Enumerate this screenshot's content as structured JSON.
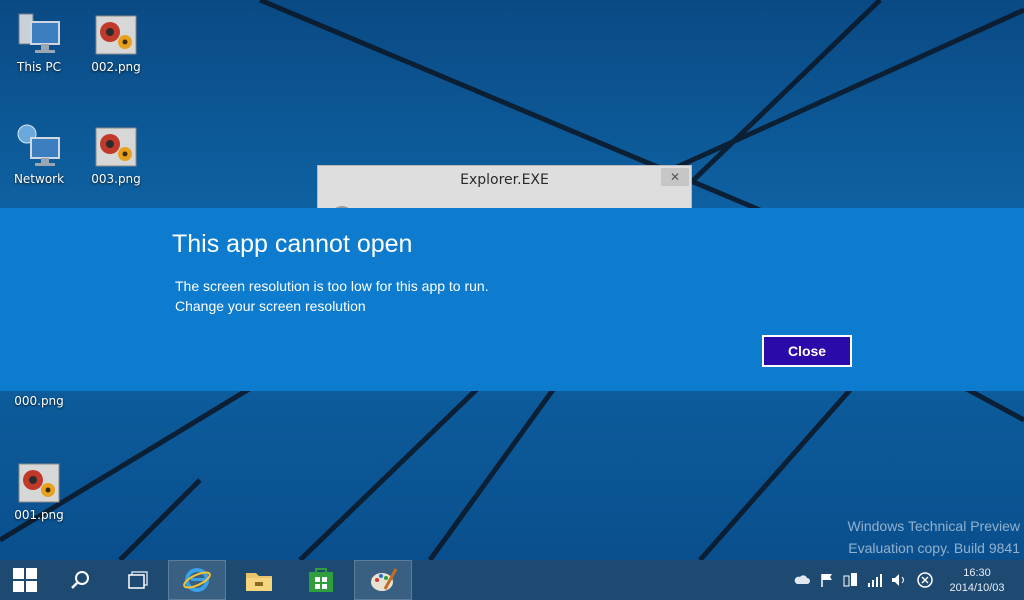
{
  "desktop_icons": [
    {
      "label": "This PC",
      "icon": "computer-icon"
    },
    {
      "label": "002.png",
      "icon": "image-icon"
    },
    {
      "label": "Network",
      "icon": "network-icon"
    },
    {
      "label": "003.png",
      "icon": "image-icon"
    },
    {
      "label": "000.png",
      "icon": "image-icon"
    },
    {
      "label": "001.png",
      "icon": "image-icon"
    }
  ],
  "background_window": {
    "title": "Explorer.EXE",
    "close_glyph": "✕"
  },
  "dialog": {
    "title": "This app cannot open",
    "message_line1": "The screen resolution is too low for this app to run.",
    "message_line2": "Change your screen resolution",
    "close_label": "Close",
    "band_color": "#0d7ccf",
    "button_color": "#2a0aa8"
  },
  "watermark": {
    "line1": "Windows Technical Preview",
    "line2": "Evaluation copy. Build 9841"
  },
  "taskbar": {
    "items": [
      {
        "icon": "start-icon"
      },
      {
        "icon": "search-icon"
      },
      {
        "icon": "task-view-icon"
      },
      {
        "icon": "internet-explorer-icon"
      },
      {
        "icon": "file-explorer-icon"
      },
      {
        "icon": "store-icon"
      },
      {
        "icon": "paint-icon"
      }
    ],
    "tray": [
      "onedrive-icon",
      "action-center-flag-icon",
      "device-icon",
      "network-signal-icon",
      "volume-icon",
      "close-circle-icon"
    ],
    "time": "16:30",
    "date": "2014/10/03"
  }
}
